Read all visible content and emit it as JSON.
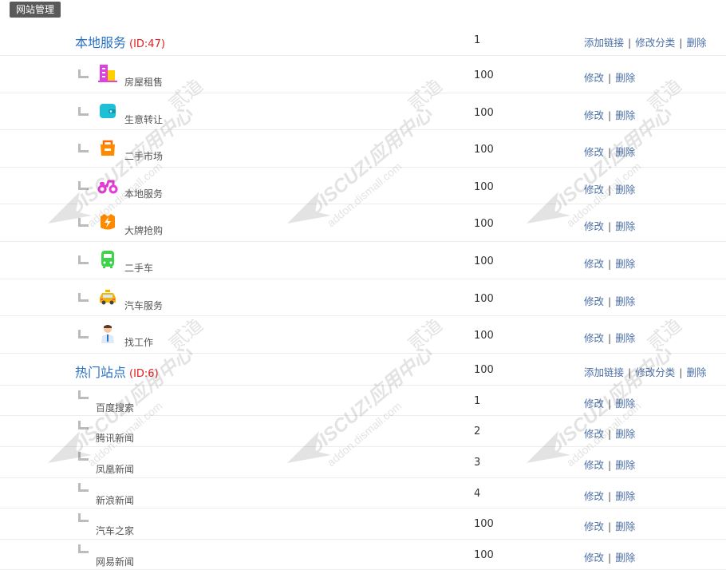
{
  "header": {
    "badge": "网站管理"
  },
  "ops": {
    "add_link": "添加链接",
    "edit_category": "修改分类",
    "edit": "修改",
    "delete": "删除",
    "sep": "|"
  },
  "groups": [
    {
      "title": "本地服务",
      "id_label": "(ID:47)",
      "order": "1",
      "items": [
        {
          "name": "房屋租售",
          "order": "100",
          "icon": "building-icon",
          "color": "#e040e0"
        },
        {
          "name": "生意转让",
          "order": "100",
          "icon": "wallet-icon",
          "color": "#1ec0d8"
        },
        {
          "name": "二手市场",
          "order": "100",
          "icon": "market-bag-icon",
          "color": "#ff8a00"
        },
        {
          "name": "本地服务",
          "order": "100",
          "icon": "scooter-icon",
          "color": "#e83ad8"
        },
        {
          "name": "大牌抢购",
          "order": "100",
          "icon": "flash-sale-icon",
          "color": "#ff8a00"
        },
        {
          "name": "二手车",
          "order": "100",
          "icon": "bus-icon",
          "color": "#3ed34a"
        },
        {
          "name": "汽车服务",
          "order": "100",
          "icon": "taxi-icon",
          "color": "#f5b400"
        },
        {
          "name": "找工作",
          "order": "100",
          "icon": "worker-icon",
          "color": "#f0a070"
        }
      ]
    },
    {
      "title": "热门站点",
      "id_label": "(ID:6)",
      "order": "100",
      "items": [
        {
          "name": "百度搜索",
          "order": "1"
        },
        {
          "name": "腾讯新闻",
          "order": "2"
        },
        {
          "name": "凤凰新闻",
          "order": "3"
        },
        {
          "name": "新浪新闻",
          "order": "4"
        },
        {
          "name": "汽车之家",
          "order": "100"
        },
        {
          "name": "网易新闻",
          "order": "100"
        }
      ]
    }
  ],
  "watermark": {
    "brand": "DISCUZ!应用中心",
    "domain": "addon.dismall.com",
    "suffix": "贰道"
  },
  "colors": {
    "link": "#4a6fa5",
    "category": "#2a72c5",
    "id": "#e02020",
    "badge_bg": "#595959"
  }
}
